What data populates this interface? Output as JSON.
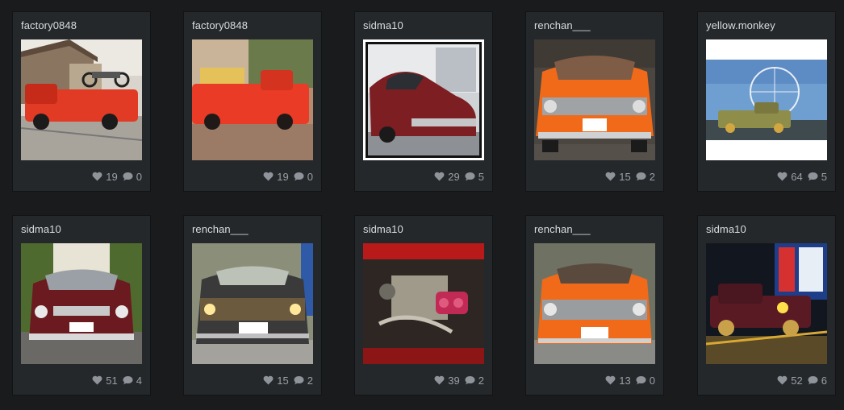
{
  "colors": {
    "background": "#191b1d",
    "card": "#25282b",
    "text": "#d9dcdf",
    "meta": "#9aa0a6"
  },
  "icons": {
    "like": "heart-icon",
    "comment": "comment-bubble-icon"
  },
  "posts": [
    {
      "user": "factory0848",
      "likes": "19",
      "comments": "0",
      "photo": "red-pickup-with-motorcycle"
    },
    {
      "user": "factory0848",
      "likes": "19",
      "comments": "0",
      "photo": "red-pickup-loaded"
    },
    {
      "user": "sidma10",
      "likes": "29",
      "comments": "5",
      "photo": "maroon-sedan-polaroid"
    },
    {
      "user": "renchan___",
      "likes": "15",
      "comments": "2",
      "photo": "orange-car-front"
    },
    {
      "user": "yellow.monkey",
      "likes": "64",
      "comments": "5",
      "photo": "pickup-with-ferris-wheel"
    },
    {
      "user": "sidma10",
      "likes": "51",
      "comments": "4",
      "photo": "maroon-car-front-trees"
    },
    {
      "user": "renchan___",
      "likes": "15",
      "comments": "2",
      "photo": "dark-car-front"
    },
    {
      "user": "sidma10",
      "likes": "39",
      "comments": "2",
      "photo": "engine-bay"
    },
    {
      "user": "renchan___",
      "likes": "13",
      "comments": "0",
      "photo": "orange-car-front-grille"
    },
    {
      "user": "sidma10",
      "likes": "52",
      "comments": "6",
      "photo": "maroon-pickup-night"
    }
  ]
}
